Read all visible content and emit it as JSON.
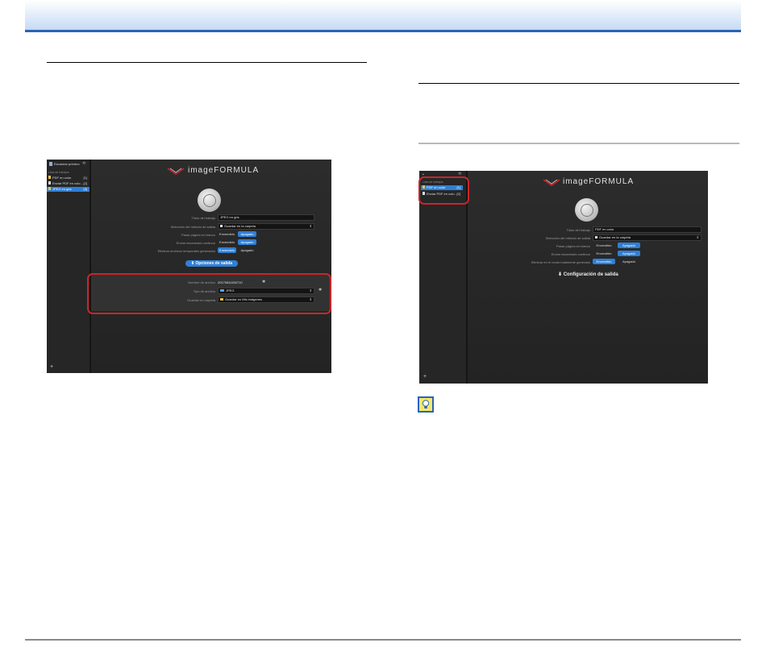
{
  "left_screenshot": {
    "sidebar": {
      "scan_first": "Escanear primero",
      "list_header": "Lista de trabajos",
      "items": [
        {
          "label": "PDF en color",
          "count": "[1]"
        },
        {
          "label": "Enviar PDF en colo...",
          "count": "[2]"
        },
        {
          "label": "JPEG en gris",
          "count": "[3]"
        }
      ]
    },
    "logo": "imageFORMULA",
    "form": {
      "job_title_label": "Título del trabajo",
      "job_title_value": "JPEG en gris",
      "destination_label": "Selección del método de salida",
      "destination_value": "Guardar en la carpeta",
      "blank_skip_label": "Pasar página en blanco",
      "continuous_label": "Enviar escaneado continuo",
      "auto_delete_label": "Eliminar archivos temporales generados",
      "on": "Encendido",
      "off": "Apagado"
    },
    "output_button": "Opciones de salida",
    "output": {
      "filename_label": "Nombre de archivo",
      "filename_value": "20170811150710",
      "filetype_label": "Tipo de archivo",
      "filetype_value": "JPEG",
      "save_label": "Guardar en carpeta",
      "save_value": "Guardar en Mis imágenes"
    }
  },
  "right_screenshot": {
    "sidebar": {
      "list_header": "Lista de trabajos",
      "items": [
        {
          "label": "PDF en color",
          "count": "[1]"
        },
        {
          "label": "Enviar PDF en colo...",
          "count": "[2]"
        }
      ]
    },
    "logo": "imageFORMULA",
    "form": {
      "job_title_label": "Título del trabajo",
      "job_title_value": "PDF en color",
      "destination_label": "Selección del método de salida",
      "destination_value": "Guardar en la carpeta",
      "blank_skip_label": "Pasar página en blanco",
      "continuous_label": "Enviar escaneado continuo",
      "auto_delete_label": "Eliminar en el modo totalmente generado",
      "on": "Encendido",
      "off": "Apagado"
    },
    "output_button": "Configuración de salida"
  },
  "icons": {
    "hint": "lightbulb-hint-icon",
    "start": "start-scan-icon"
  }
}
